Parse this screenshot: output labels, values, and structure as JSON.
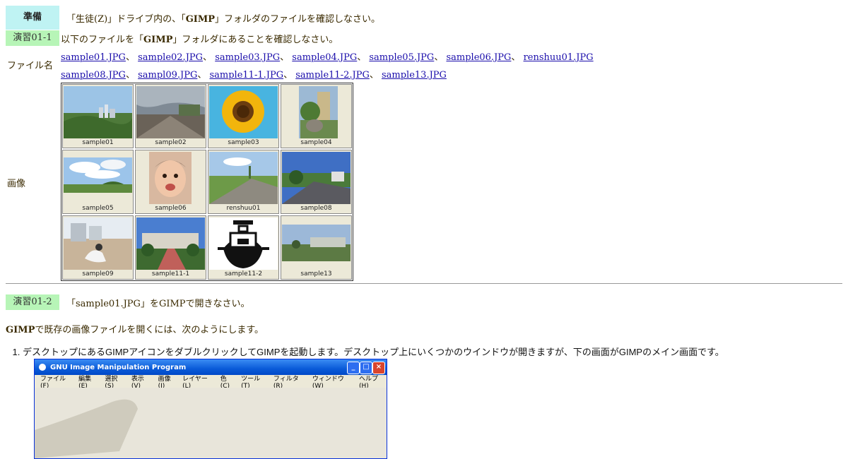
{
  "prep": {
    "label": "準備",
    "text_pre": "「生徒(Z)」ドライブ内の、「",
    "text_bold": "GIMP",
    "text_post": "」フォルダのファイルを確認しなさい。"
  },
  "ex1": {
    "label": "演習01-1",
    "text_pre": "以下のファイルを「",
    "text_bold": "GIMP",
    "text_post": "」フォルダにあることを確認しなさい。"
  },
  "files": {
    "label": "ファイル名",
    "row1": [
      "sample01.JPG",
      "sample02.JPG",
      "sample03.JPG",
      "sample04.JPG",
      "sample05.JPG",
      "sample06.JPG",
      "renshuu01.JPG"
    ],
    "row2": [
      "sample08.JPG",
      "sampl09.JPG",
      "sample11-1.JPG",
      "sample11-2.JPG",
      "sample13.JPG"
    ],
    "sep": "、"
  },
  "images": {
    "label": "画像",
    "captions": [
      "sample01",
      "sample02",
      "sample03",
      "sample04",
      "sample05",
      "sample06",
      "renshuu01",
      "sample08",
      "sample09",
      "sample11-1",
      "sample11-2",
      "sample13"
    ]
  },
  "ex2": {
    "label": "演習01-2",
    "text": "「sample01.JPG」をGIMPで開きなさい。"
  },
  "intro": {
    "bold": "GIMP",
    "text": "で既存の画像ファイルを開くには、次のようにします。"
  },
  "steps": [
    "デスクトップにあるGIMPアイコンをダブルクリックしてGIMPを起動します。デスクトップ上にいくつかのウインドウが開きますが、下の画面がGIMPのメイン画面です。"
  ],
  "gimp_window": {
    "title": "GNU Image Manipulation Program",
    "menus": [
      "ファイル(F)",
      "編集(E)",
      "選択(S)",
      "表示(V)",
      "画像(I)",
      "レイヤー(L)",
      "色(C)",
      "ツール(T)",
      "フィルタ(R)",
      "ウィンドウ(W)",
      "ヘルプ(H)"
    ]
  }
}
